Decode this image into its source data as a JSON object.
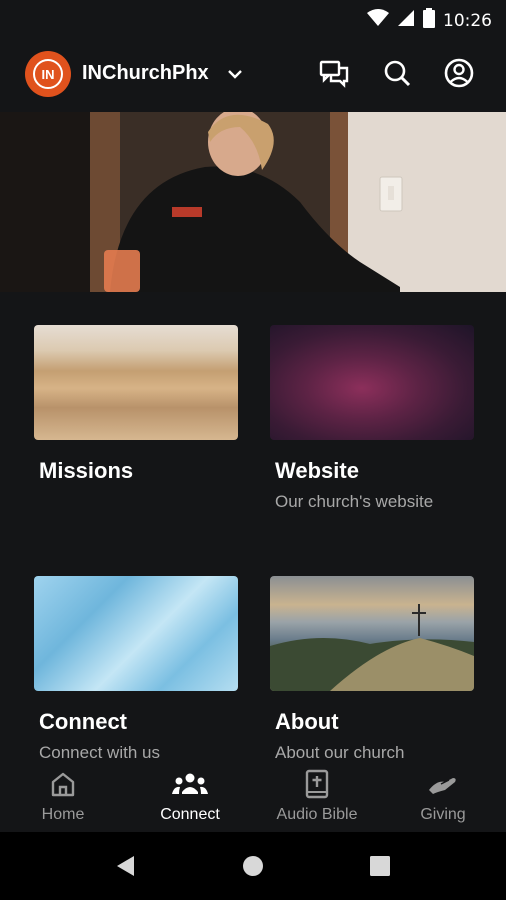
{
  "status_bar": {
    "time": "10:26",
    "icons": [
      "wifi-icon",
      "signal-icon",
      "battery-icon"
    ]
  },
  "app_bar": {
    "logo_text": "IN",
    "church_name": "INChurchPhx",
    "icons": [
      "chat-icon",
      "search-icon",
      "account-icon"
    ]
  },
  "cards": [
    {
      "title": "Missions",
      "subtitle": ""
    },
    {
      "title": "Website",
      "subtitle": "Our church's website"
    },
    {
      "title": "Connect",
      "subtitle": "Connect with us"
    },
    {
      "title": "About",
      "subtitle": "About our church"
    }
  ],
  "bottom_nav": {
    "items": [
      {
        "label": "Home",
        "icon": "home-icon",
        "active": false
      },
      {
        "label": "Connect",
        "icon": "people-icon",
        "active": true
      },
      {
        "label": "Audio Bible",
        "icon": "bible-icon",
        "active": false
      },
      {
        "label": "Giving",
        "icon": "giving-hand-icon",
        "active": false
      }
    ]
  },
  "colors": {
    "background": "#141517",
    "brand": "#e0521d",
    "text_primary": "#ffffff",
    "text_secondary": "#a8a8a8"
  }
}
